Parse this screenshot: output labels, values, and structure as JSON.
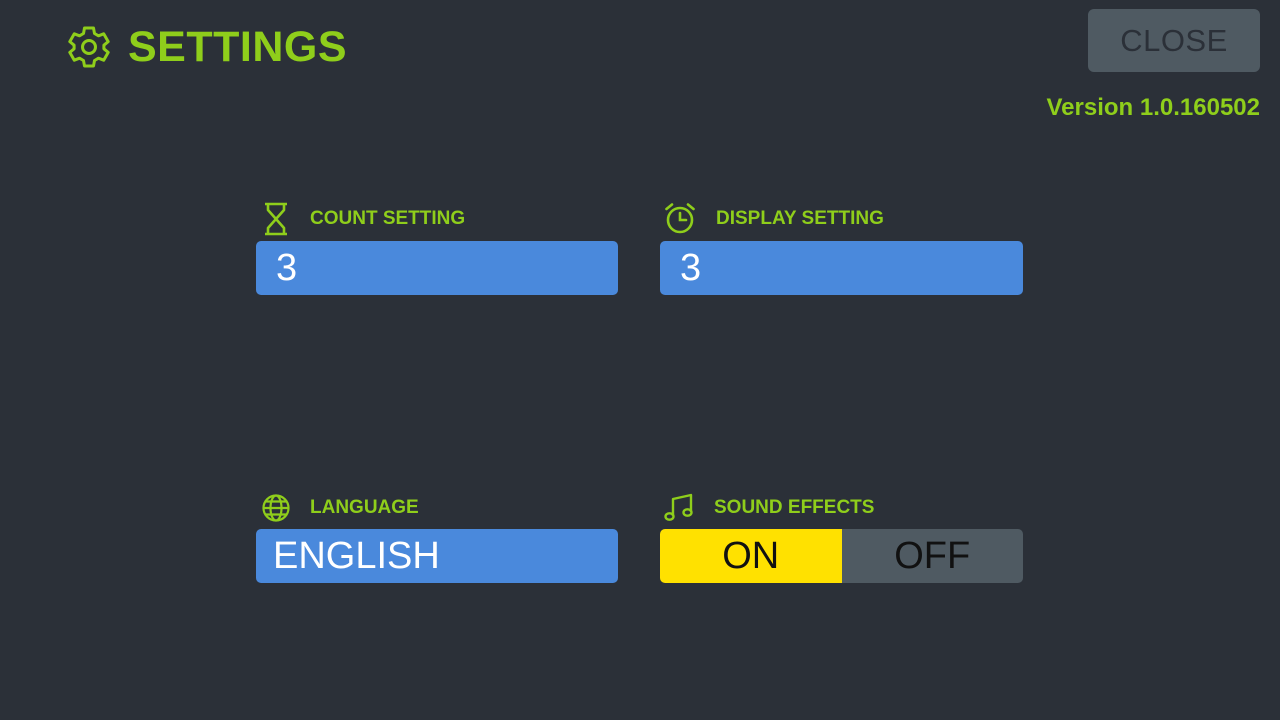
{
  "header": {
    "title": "SETTINGS",
    "close_label": "CLOSE",
    "version": "Version 1.0.160502"
  },
  "settings": {
    "count": {
      "label": "COUNT SETTING",
      "value": "3",
      "icon": "hourglass-icon"
    },
    "display": {
      "label": "DISPLAY SETTING",
      "value": "3",
      "icon": "alarm-clock-icon"
    },
    "language": {
      "label": "LANGUAGE",
      "value": "ENGLISH",
      "icon": "globe-icon"
    },
    "sound": {
      "label": "SOUND EFFECTS",
      "on_label": "ON",
      "off_label": "OFF",
      "selected": "ON",
      "icon": "music-note-icon"
    }
  },
  "colors": {
    "background": "#2b3038",
    "accent": "#8fce1b",
    "field": "#4a89dc",
    "toggle_on": "#ffe100",
    "toggle_off": "#4f5a62",
    "close_button": "#4f5a62"
  }
}
